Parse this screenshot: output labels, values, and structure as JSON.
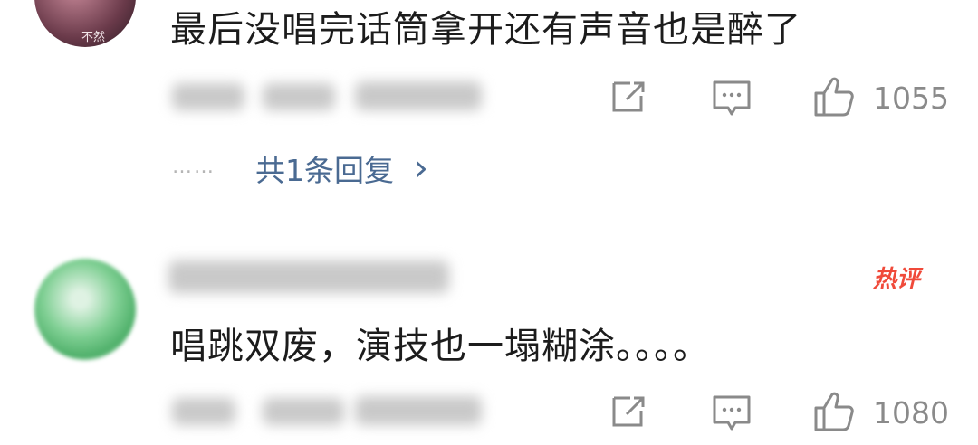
{
  "comments": [
    {
      "avatar_watermark": "不然",
      "text": "最后没唱完话筒拿开还有声音也是醉了",
      "likes": "1055",
      "reply_summary": "共1条回复",
      "reply_chevron": "›"
    },
    {
      "badge": "热评",
      "text": "唱跳双废，演技也一塌糊涂。。。。",
      "likes": "1080"
    }
  ],
  "icons": {
    "share": "share-icon",
    "comment": "comment-icon",
    "like": "thumbs-up-icon"
  },
  "dots": "……",
  "colors": {
    "link": "#4a6a92",
    "badge": "#f04a3a",
    "icon": "#8a8a8a"
  }
}
